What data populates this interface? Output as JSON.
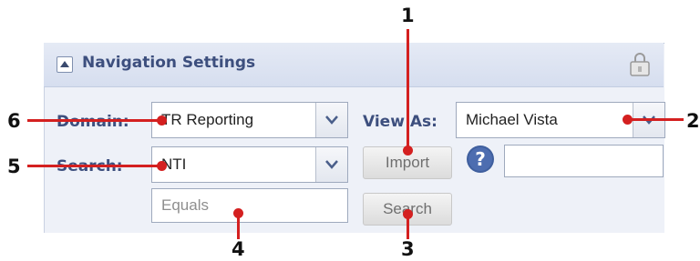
{
  "panel": {
    "title": "Navigation Settings",
    "icons": {
      "collapse": "triangle-up-icon",
      "lock": "lock-icon"
    }
  },
  "form": {
    "domain_label": "Domain:",
    "domain_value": "TR Reporting",
    "search_label": "Search:",
    "search_value": "NTI",
    "equals_placeholder": "Equals",
    "view_as_label": "View As:",
    "view_as_value": "Michael Vista",
    "import_label": "Import",
    "search_button_label": "Search",
    "help_icon": "question-icon"
  },
  "callouts": [
    "1",
    "2",
    "3",
    "4",
    "5",
    "6"
  ],
  "colors": {
    "callout": "#d42020",
    "label_text": "#3d4f7e",
    "panel_bg": "#eef1f8"
  }
}
